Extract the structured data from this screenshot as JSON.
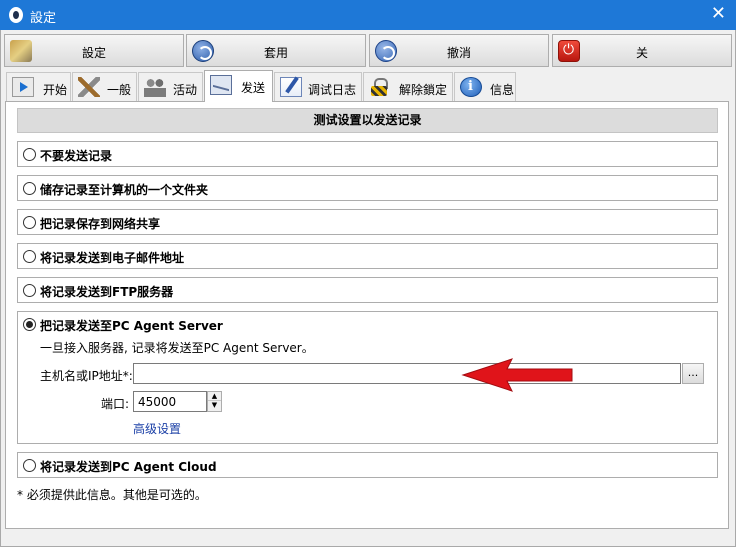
{
  "window": {
    "title": "設定",
    "close_glyph": "✕"
  },
  "toolbar": {
    "settings_label": "設定",
    "apply_label": "套用",
    "cancel_label": "撤消",
    "close_label": "关"
  },
  "tabs": [
    {
      "label": "开始",
      "icon": "play-icon"
    },
    {
      "label": "一般",
      "icon": "tools-icon"
    },
    {
      "label": "活动",
      "icon": "people-icon"
    },
    {
      "label": "发送",
      "icon": "mail-icon",
      "active": true
    },
    {
      "label": "调试日志",
      "icon": "log-icon"
    },
    {
      "label": "解除鎖定",
      "icon": "lock-icon"
    },
    {
      "label": "信息",
      "icon": "info-icon"
    }
  ],
  "send": {
    "header": "测试设置以发送记录",
    "options": [
      {
        "label": "不要发送记录",
        "selected": false
      },
      {
        "label": "储存记录至计算机的一个文件夹",
        "selected": false
      },
      {
        "label": "把记录保存到网络共享",
        "selected": false
      },
      {
        "label": "将记录发送到电子邮件地址",
        "selected": false
      },
      {
        "label": "将记录发送到FTP服务器",
        "selected": false
      }
    ],
    "server": {
      "label": "把记录发送至PC Agent Server",
      "selected": true,
      "description": "一旦接入服务器, 记录将发送至PC Agent Server。",
      "host_label": "主机名或IP地址*:",
      "host_value": "",
      "browse_label": "...",
      "port_label": "端口:",
      "port_value": "45000",
      "advanced_label": "高级设置"
    },
    "cloud": {
      "label": "将记录发送到PC Agent Cloud",
      "selected": false
    },
    "footnote": "* 必须提供此信息。其他是可选的。"
  },
  "colors": {
    "titlebar": "#1e78d7",
    "arrow": "#e0141a",
    "link": "#1a3fa6"
  }
}
